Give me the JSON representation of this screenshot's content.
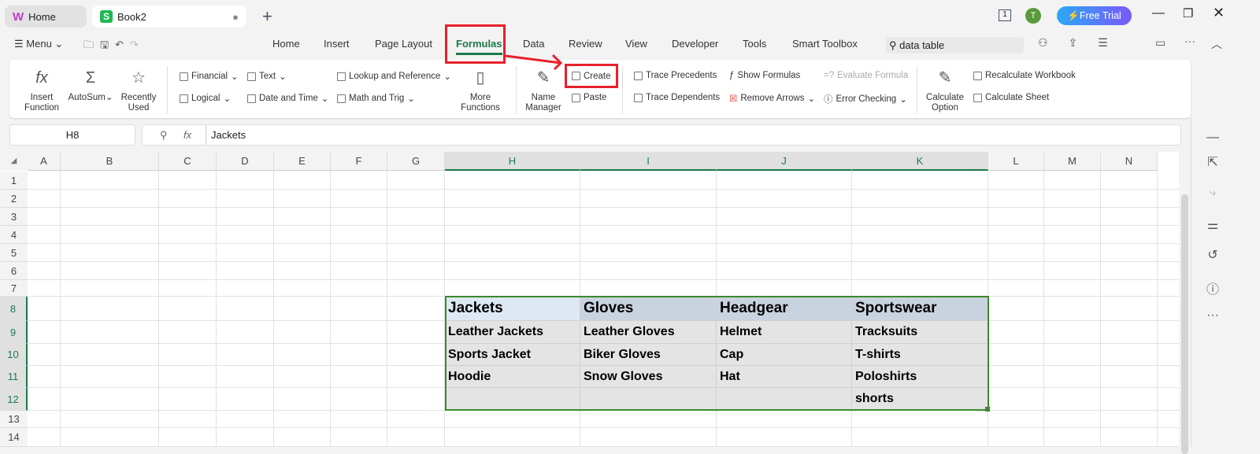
{
  "tabs": [
    {
      "label": "Home",
      "icon": "wps-logo-icon"
    },
    {
      "label": "Book2",
      "icon": "spreadsheet-icon",
      "active": true
    }
  ],
  "titlebar": {
    "free_trial": "Free Trial",
    "avatar": "T",
    "page_count": "1"
  },
  "menu": {
    "menu_label": "Menu",
    "tabs": [
      "Home",
      "Insert",
      "Page Layout",
      "Formulas",
      "Data",
      "Review",
      "View",
      "Developer",
      "Tools",
      "Smart Toolbox"
    ],
    "active_tab": "Formulas",
    "search_value": "data table"
  },
  "ribbon": {
    "insert_function": "Insert\nFunction",
    "autosum": "AutoSum",
    "recently_used": "Recently\nUsed",
    "financial": "Financial",
    "text": "Text",
    "lookup": "Lookup and Reference",
    "logical": "Logical",
    "date_time": "Date and Time",
    "math_trig": "Math and Trig",
    "more_functions": "More\nFunctions",
    "name_manager": "Name\nManager",
    "create": "Create",
    "paste": "Paste",
    "trace_precedents": "Trace Precedents",
    "trace_dependents": "Trace Dependents",
    "show_formulas": "Show Formulas",
    "remove_arrows": "Remove Arrows",
    "evaluate_formula": "Evaluate Formula",
    "error_checking": "Error Checking",
    "calculate_option": "Calculate\nOption",
    "recalculate_workbook": "Recalculate Workbook",
    "calculate_sheet": "Calculate Sheet"
  },
  "formula_bar": {
    "cell_ref": "H8",
    "fx": "fx",
    "value": "Jackets"
  },
  "columns": [
    "A",
    "B",
    "C",
    "D",
    "E",
    "F",
    "G",
    "H",
    "I",
    "J",
    "K",
    "L",
    "M",
    "N"
  ],
  "rows": [
    "1",
    "2",
    "3",
    "4",
    "5",
    "6",
    "7",
    "8",
    "9",
    "10",
    "11",
    "12",
    "13",
    "14"
  ],
  "table": {
    "headers": [
      "Jackets",
      "Gloves",
      "Headgear",
      "Sportswear"
    ],
    "body": [
      [
        "Leather Jackets",
        "Leather Gloves",
        "Helmet",
        "Tracksuits"
      ],
      [
        "Sports Jacket",
        "Biker Gloves",
        "Cap",
        "T-shirts"
      ],
      [
        "Hoodie",
        "Snow Gloves",
        "Hat",
        "Poloshirts"
      ],
      [
        "",
        "",
        "",
        "shorts"
      ]
    ]
  },
  "colors": {
    "accent": "#1a7a4a",
    "annotation": "#e8202a",
    "selection": "#3a8a2a"
  }
}
